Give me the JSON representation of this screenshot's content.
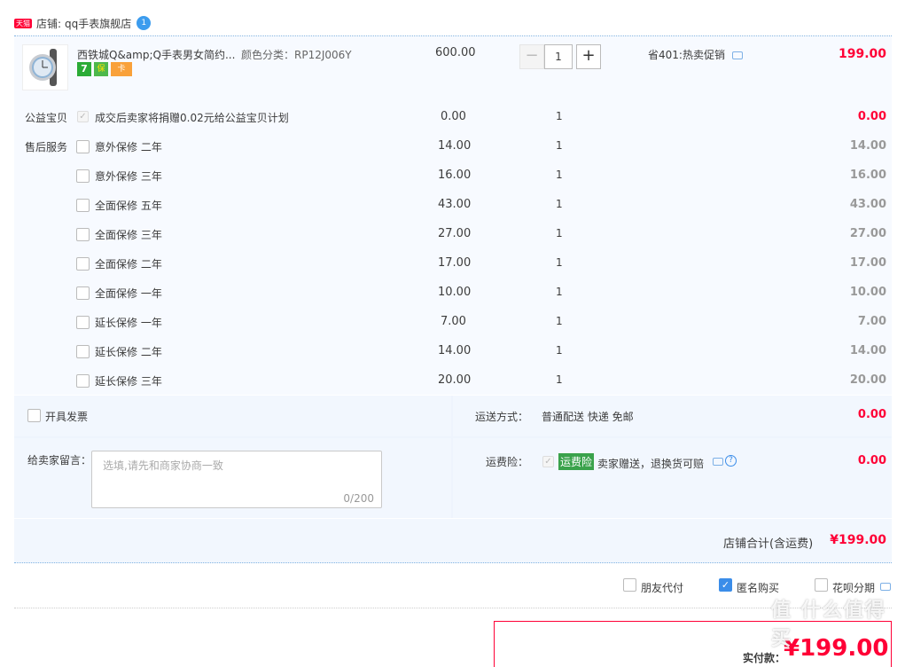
{
  "shop": {
    "badge": "天猫",
    "label": "店铺:",
    "name": "qq手表旗舰店",
    "chat_badge": "1"
  },
  "item": {
    "title": "西铁城Q&amp;Q手表男女简约...",
    "sku": "颜色分类：RP12J006Y",
    "unit_price": "600.00",
    "quantity": "1",
    "promo": "省401:热卖促销",
    "subtotal": "199.00",
    "service_badges": [
      "7",
      "保",
      "卡"
    ]
  },
  "charity": {
    "label": "公益宝贝",
    "text": "成交后卖家将捐赠0.02元给公益宝贝计划",
    "price": "0.00",
    "qty": "1",
    "total": "0.00"
  },
  "aftersale": {
    "label": "售后服务",
    "rows": [
      {
        "name": "意外保修 二年",
        "price": "14.00",
        "qty": "1",
        "total": "14.00"
      },
      {
        "name": "意外保修 三年",
        "price": "16.00",
        "qty": "1",
        "total": "16.00"
      },
      {
        "name": "全面保修 五年",
        "price": "43.00",
        "qty": "1",
        "total": "43.00"
      },
      {
        "name": "全面保修 三年",
        "price": "27.00",
        "qty": "1",
        "total": "27.00"
      },
      {
        "name": "全面保修 二年",
        "price": "17.00",
        "qty": "1",
        "total": "17.00"
      },
      {
        "name": "全面保修 一年",
        "price": "10.00",
        "qty": "1",
        "total": "10.00"
      },
      {
        "name": "延长保修 一年",
        "price": "7.00",
        "qty": "1",
        "total": "7.00"
      },
      {
        "name": "延长保修 二年",
        "price": "14.00",
        "qty": "1",
        "total": "14.00"
      },
      {
        "name": "延长保修 三年",
        "price": "20.00",
        "qty": "1",
        "total": "20.00"
      }
    ]
  },
  "invoice": {
    "label": "开具发票"
  },
  "shipping": {
    "label": "运送方式：",
    "value": "普通配送 快递 免邮",
    "price": "0.00"
  },
  "message": {
    "label": "给卖家留言：",
    "placeholder": "选填,请先和商家协商一致",
    "counter": "0/200"
  },
  "insurance": {
    "label": "运费险：",
    "tag": "运费险",
    "text": "卖家赠送，退换货可赔",
    "price": "0.00"
  },
  "shop_total": {
    "label": "店铺合计(含运费)",
    "value": "¥199.00"
  },
  "options": [
    {
      "label": "朋友代付",
      "checked": false
    },
    {
      "label": "匿名购买",
      "checked": true
    },
    {
      "label": "花呗分期",
      "checked": false
    }
  ],
  "payment": {
    "label": "实付款：",
    "value": "¥199.00"
  },
  "watermark": "值 什么值得买",
  "colors": {
    "accent": "#ff0036",
    "row_bg": "#f7faff",
    "border": "#80b2e1"
  }
}
